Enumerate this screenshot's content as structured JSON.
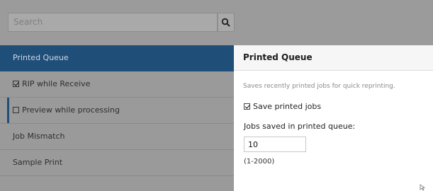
{
  "search": {
    "placeholder": "Search",
    "icon": "search-icon"
  },
  "sidebar": {
    "items": [
      {
        "label": "Printed Queue",
        "active": true
      },
      {
        "label": "RIP while Receive",
        "checkbox": true,
        "checked": true
      },
      {
        "label": "Preview while processing",
        "checkbox": true,
        "checked": false
      },
      {
        "label": "Job Mismatch"
      },
      {
        "label": "Sample Print"
      }
    ]
  },
  "panel": {
    "title": "Printed Queue",
    "description": "Saves recently printed jobs for quick reprinting.",
    "save_checkbox_label": "Save printed jobs",
    "save_checked": true,
    "queue_label": "Jobs saved in printed queue:",
    "queue_value": "10",
    "range_hint": "(1-2000)"
  },
  "colors": {
    "accent": "#1f4e79",
    "overlay": "#9a9a9a"
  }
}
